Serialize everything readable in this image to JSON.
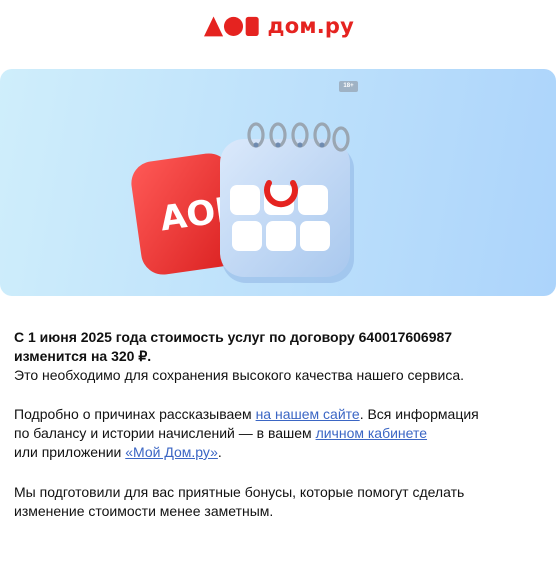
{
  "header": {
    "logo_text": "дом.ру"
  },
  "banner": {
    "age_rating": "18+",
    "logo_text": "АОЙ"
  },
  "message": {
    "lead_line1": "С 1 июня 2025 года стоимость услуг по договору 640017606987",
    "lead_line2": "изменится на 320 ₽.",
    "reason": "Это необходимо для сохранения высокого качества нашего сервиса.",
    "details_before": "Подробно о причинах рассказываем ",
    "site_link": "на нашем сайте",
    "details_middle_1": ". Вся информация",
    "details_middle_2": "по балансу и истории начислений — в вашем ",
    "cabinet_link": "личном кабинете",
    "details_middle_3": "или приложении ",
    "app_link": "«Мой Дом.ру»",
    "details_end": ".",
    "bonus_line1": "Мы подготовили для вас приятные бонусы, которые помогут сделать",
    "bonus_line2": "изменение стоимости менее заметным."
  },
  "colors": {
    "brand_red": "#e52320",
    "link_blue": "#3b66c4",
    "banner_gradient_start": "#cfeefb",
    "banner_gradient_end": "#acd4fb"
  }
}
